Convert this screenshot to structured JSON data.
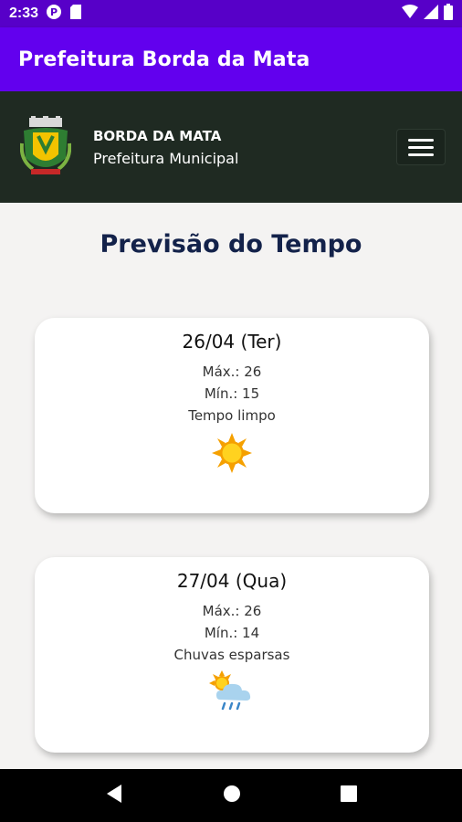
{
  "status_bar": {
    "time": "2:33"
  },
  "app_bar": {
    "title": "Prefeitura Borda da Mata"
  },
  "header": {
    "name": "BORDA DA MATA",
    "subtitle": "Prefeitura Municipal"
  },
  "page": {
    "title": "Previsão do Tempo"
  },
  "forecasts": [
    {
      "date": "26/04 (Ter)",
      "max": "Máx.: 26",
      "min": "Mín.: 15",
      "condition": "Tempo limpo",
      "icon": "sun-icon"
    },
    {
      "date": "27/04 (Qua)",
      "max": "Máx.: 26",
      "min": "Mín.: 14",
      "condition": "Chuvas esparsas",
      "icon": "sun-cloud-rain-icon"
    }
  ]
}
